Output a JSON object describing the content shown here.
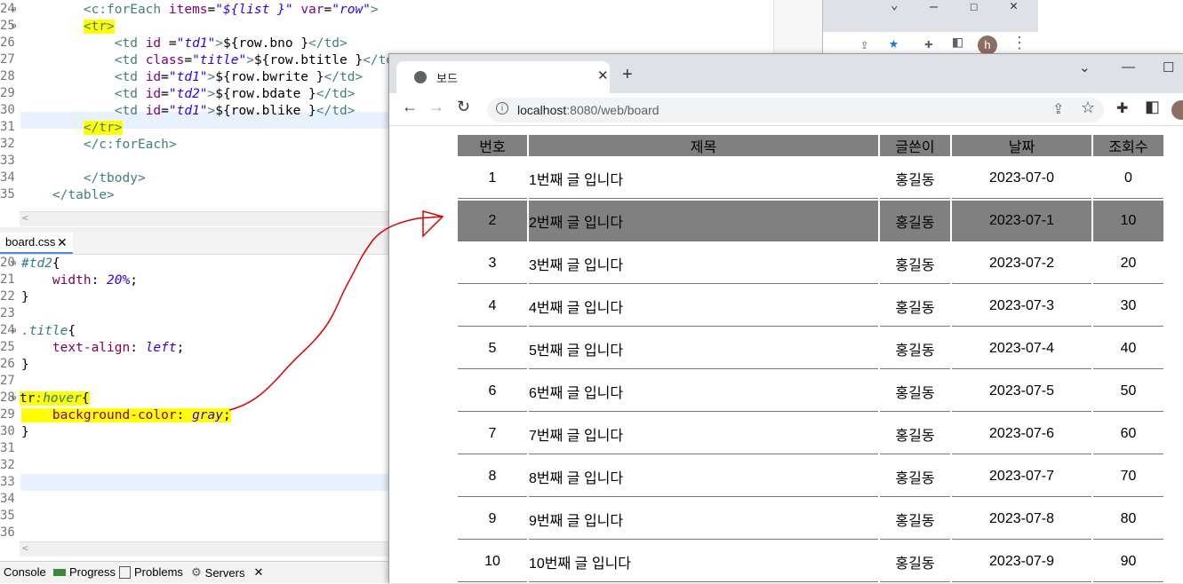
{
  "jsp_editor": {
    "line_numbers": [
      "24",
      "25",
      "26",
      "27",
      "28",
      "29",
      "30",
      "31",
      "32",
      "33",
      "34",
      "35"
    ],
    "lines": [
      {
        "parts": [
          [
            "tag",
            "<c:forEach "
          ],
          [
            "attr",
            "items"
          ],
          [
            "ttext",
            "="
          ],
          [
            "str",
            "\"${list }\""
          ],
          [
            "ttext",
            " "
          ],
          [
            "attr",
            "var"
          ],
          [
            "ttext",
            "="
          ],
          [
            "str",
            "\"row\""
          ],
          [
            "tag",
            ">"
          ]
        ],
        "indent": "        "
      },
      {
        "parts": [
          [
            "tag",
            "<tr>"
          ]
        ],
        "indent": "        ",
        "yellow": true
      },
      {
        "parts": [
          [
            "tag",
            "<td "
          ],
          [
            "attr",
            "id "
          ],
          [
            "ttext",
            "="
          ],
          [
            "str",
            "\"td1\""
          ],
          [
            "tag",
            ">"
          ],
          [
            "ttext",
            "${row.bno }"
          ],
          [
            "tag",
            "</td>"
          ]
        ],
        "indent": "            "
      },
      {
        "parts": [
          [
            "tag",
            "<td "
          ],
          [
            "attr",
            "class"
          ],
          [
            "ttext",
            "="
          ],
          [
            "str",
            "\"title\""
          ],
          [
            "tag",
            ">"
          ],
          [
            "ttext",
            "${row.btitle }"
          ],
          [
            "tag",
            "</td>"
          ]
        ],
        "indent": "            "
      },
      {
        "parts": [
          [
            "tag",
            "<td "
          ],
          [
            "attr",
            "id"
          ],
          [
            "ttext",
            "="
          ],
          [
            "str",
            "\"td1\""
          ],
          [
            "tag",
            ">"
          ],
          [
            "ttext",
            "${row.bwrite }"
          ],
          [
            "tag",
            "</td>"
          ]
        ],
        "indent": "            "
      },
      {
        "parts": [
          [
            "tag",
            "<td "
          ],
          [
            "attr",
            "id"
          ],
          [
            "ttext",
            "="
          ],
          [
            "str",
            "\"td2\""
          ],
          [
            "tag",
            ">"
          ],
          [
            "ttext",
            "${row.bdate }"
          ],
          [
            "tag",
            "</td>"
          ]
        ],
        "indent": "            "
      },
      {
        "parts": [
          [
            "tag",
            "<td "
          ],
          [
            "attr",
            "id"
          ],
          [
            "ttext",
            "="
          ],
          [
            "str",
            "\"td1\""
          ],
          [
            "tag",
            ">"
          ],
          [
            "ttext",
            "${row.blike }"
          ],
          [
            "tag",
            "</td>"
          ]
        ],
        "indent": "            "
      },
      {
        "parts": [
          [
            "tag",
            "</tr>"
          ]
        ],
        "indent": "        ",
        "yellow": true
      },
      {
        "parts": [
          [
            "tag",
            "</c:forEach>"
          ]
        ],
        "indent": "        "
      },
      {
        "parts": [],
        "indent": ""
      },
      {
        "parts": [
          [
            "tag",
            "</tbody>"
          ]
        ],
        "indent": "        "
      },
      {
        "parts": [
          [
            "tag",
            "</table>"
          ]
        ],
        "indent": "    "
      }
    ]
  },
  "css_editor": {
    "tab_label": "board.css",
    "line_numbers": [
      "20",
      "21",
      "22",
      "23",
      "24",
      "25",
      "26",
      "27",
      "28",
      "29",
      "30",
      "31",
      "32",
      "33",
      "34",
      "35",
      "36"
    ],
    "lines": [
      [
        [
          "cssel",
          "#td2"
        ],
        [
          "ttext",
          "{"
        ]
      ],
      [
        [
          "ttext",
          "    "
        ],
        [
          "cssprop",
          "width"
        ],
        [
          "ttext",
          ": "
        ],
        [
          "cssval",
          "20%"
        ],
        [
          "ttext",
          ";"
        ]
      ],
      [
        [
          "ttext",
          "}"
        ]
      ],
      [],
      [
        [
          "cssel",
          ".title"
        ],
        [
          "ttext",
          "{"
        ]
      ],
      [
        [
          "ttext",
          "    "
        ],
        [
          "cssprop",
          "text-align"
        ],
        [
          "ttext",
          ": "
        ],
        [
          "cssval",
          "left"
        ],
        [
          "ttext",
          ";"
        ]
      ],
      [
        [
          "ttext",
          "}"
        ]
      ],
      [],
      [
        [
          "ttext",
          "tr"
        ],
        [
          "cssel",
          ":hover"
        ],
        [
          "ttext",
          "{"
        ]
      ],
      [
        [
          "ttext",
          "    "
        ],
        [
          "cssprop",
          "background-color"
        ],
        [
          "ttext",
          ": "
        ],
        [
          "cssval",
          "gray"
        ],
        [
          "ttext",
          ";"
        ]
      ],
      [
        [
          "ttext",
          "}"
        ]
      ],
      [],
      [],
      [],
      [],
      [],
      []
    ]
  },
  "bottom_tabs": [
    "Console",
    "Progress",
    "Problems",
    "Servers"
  ],
  "browser": {
    "tab_title": "보드",
    "url_host": "localhost",
    "url_rest": ":8080/web/board",
    "avatar_letter": "h"
  },
  "board": {
    "headers": [
      "번호",
      "제목",
      "글쓴이",
      "날짜",
      "조회수"
    ],
    "rows": [
      [
        "1",
        "1번째 글 입니다",
        "홍길동",
        "2023-07-0",
        "0"
      ],
      [
        "2",
        "2번째 글 입니다",
        "홍길동",
        "2023-07-1",
        "10"
      ],
      [
        "3",
        "3번째 글 입니다",
        "홍길동",
        "2023-07-2",
        "20"
      ],
      [
        "4",
        "4번째 글 입니다",
        "홍길동",
        "2023-07-3",
        "30"
      ],
      [
        "5",
        "5번째 글 입니다",
        "홍길동",
        "2023-07-4",
        "40"
      ],
      [
        "6",
        "6번째 글 입니다",
        "홍길동",
        "2023-07-5",
        "50"
      ],
      [
        "7",
        "7번째 글 입니다",
        "홍길동",
        "2023-07-6",
        "60"
      ],
      [
        "8",
        "8번째 글 입니다",
        "홍길동",
        "2023-07-7",
        "70"
      ],
      [
        "9",
        "9번째 글 입니다",
        "홍길동",
        "2023-07-8",
        "80"
      ],
      [
        "10",
        "10번째 글 입니다",
        "홍길동",
        "2023-07-9",
        "90"
      ]
    ],
    "hover_row_index": 1,
    "hover_color": "#808080"
  },
  "colors": {
    "annotation": "#e00000",
    "highlight": "#ffff00"
  }
}
